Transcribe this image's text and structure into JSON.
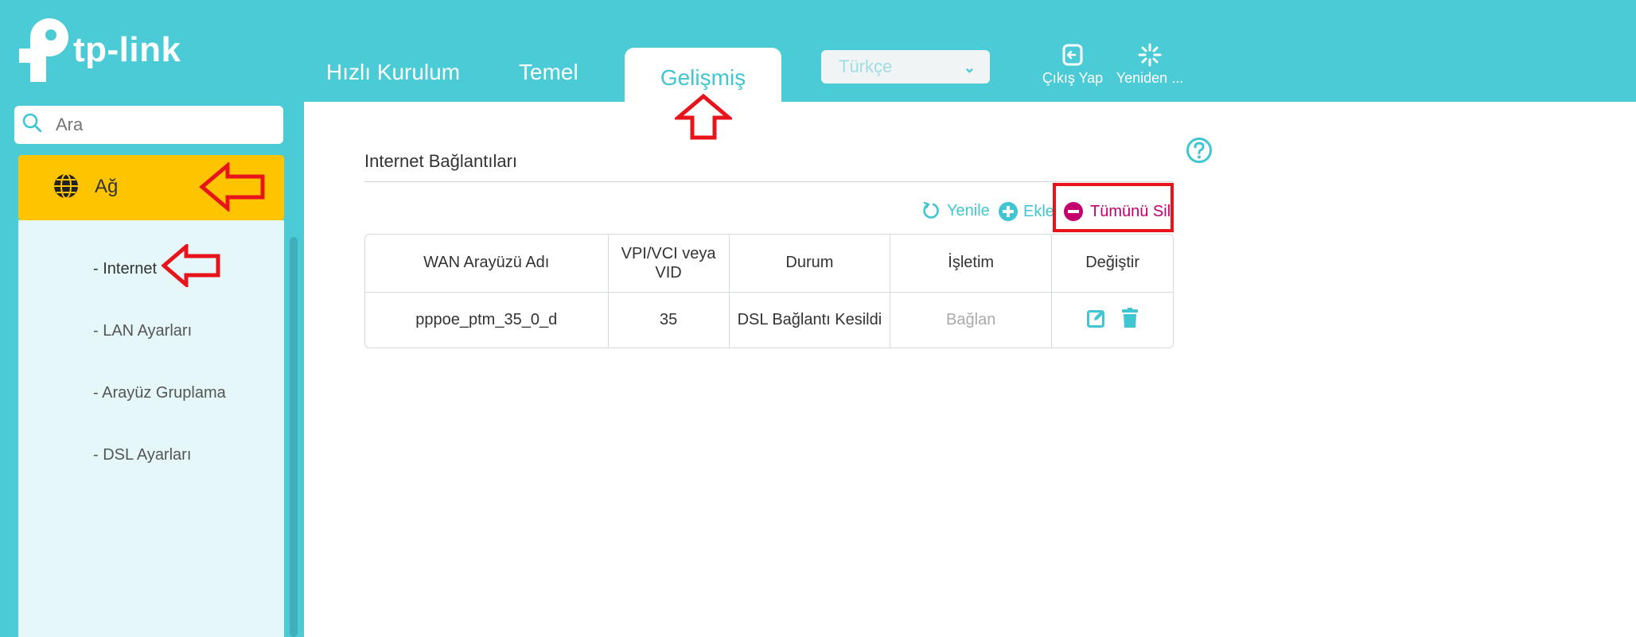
{
  "header": {
    "logo_text": "tp-link",
    "tabs": {
      "quick_setup": "Hızlı Kurulum",
      "basic": "Temel",
      "advanced": "Gelişmiş"
    },
    "language": "Türkçe",
    "logout_label": "Çıkış Yap",
    "reboot_label": "Yeniden ..."
  },
  "sidebar": {
    "search_placeholder": "Ara",
    "network_label": "Ağ",
    "items": [
      "- Internet",
      "- LAN Ayarları",
      "- Arayüz Gruplama",
      "- DSL Ayarları"
    ]
  },
  "main": {
    "title": "Internet Bağlantıları",
    "toolbar": {
      "refresh": "Yenile",
      "add": "Ekle",
      "delete_all": "Tümünü Sil"
    },
    "table": {
      "headers": [
        "WAN Arayüzü Adı",
        "VPI/VCI veya VID",
        "Durum",
        "İşletim",
        "Değiştir"
      ],
      "rows": [
        {
          "name": "pppoe_ptm_35_0_d",
          "vpi": "35",
          "status": "DSL Bağlantı Kesildi",
          "operation": "Bağlan"
        }
      ]
    }
  },
  "colors": {
    "header_bg": "#4acbd6",
    "accent": "#3fc6d2",
    "active_nav": "#ffc400",
    "delete_color": "#c3006e",
    "annotation_red": "#e8141b"
  }
}
